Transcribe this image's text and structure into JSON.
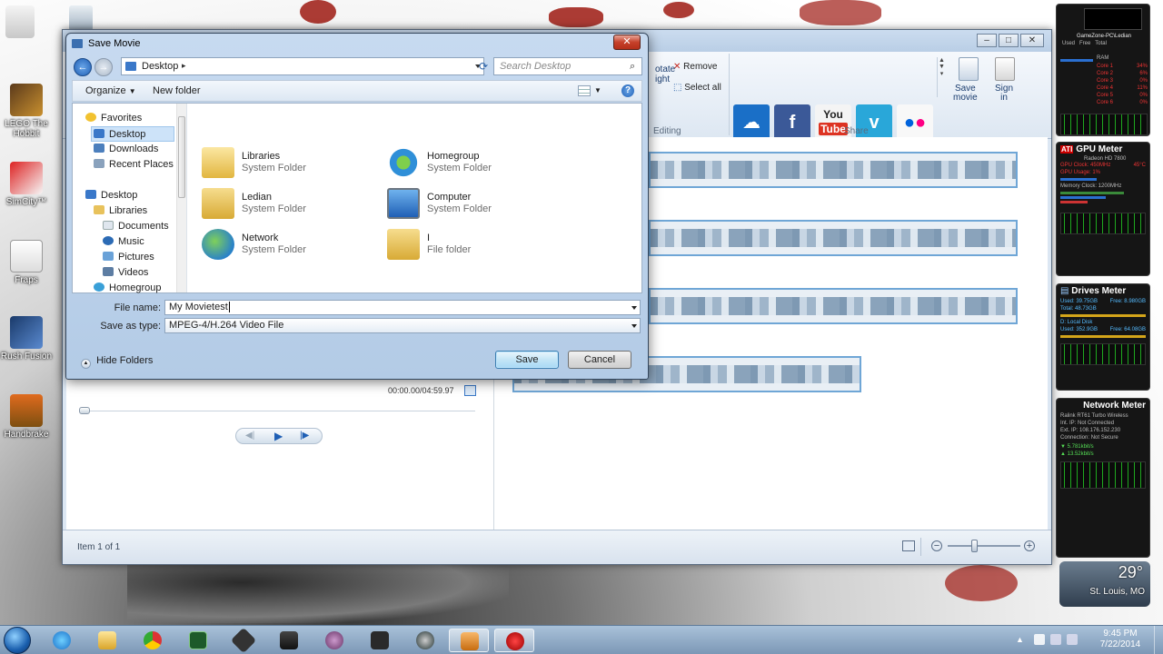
{
  "desktop": {
    "icons": [
      {
        "label": "LEGO The Hobbit"
      },
      {
        "label": "SimCity™"
      },
      {
        "label": "Fraps"
      },
      {
        "label": "Rush Fusion"
      },
      {
        "label": "Handbrake"
      }
    ]
  },
  "moviemaker": {
    "ribbon": {
      "remove": "Remove",
      "select_all": "Select all",
      "rotate_right": "otate\night",
      "editing_group": "Editing",
      "share_group": "Share",
      "save_movie": "Save\nmovie",
      "sign_in": "Sign\nin",
      "share_services": [
        "OneDrive",
        "Facebook",
        "YouTube",
        "Vimeo",
        "Flickr"
      ]
    },
    "preview": {
      "timecode": "00:00.00/04:59.97"
    },
    "status": {
      "item_count": "Item 1 of 1"
    }
  },
  "dialog": {
    "title": "Save Movie",
    "address": "Desktop",
    "search_placeholder": "Search Desktop",
    "toolbar": {
      "organize": "Organize",
      "new_folder": "New folder"
    },
    "nav": {
      "favorites": "Favorites",
      "desktop_fav": "Desktop",
      "downloads": "Downloads",
      "recent_places": "Recent Places",
      "desktop": "Desktop",
      "libraries": "Libraries",
      "documents": "Documents",
      "music": "Music",
      "pictures": "Pictures",
      "videos": "Videos",
      "homegroup": "Homegroup"
    },
    "files": [
      {
        "name": "Libraries",
        "type": "System Folder"
      },
      {
        "name": "Homegroup",
        "type": "System Folder"
      },
      {
        "name": "Ledian",
        "type": "System Folder"
      },
      {
        "name": "Computer",
        "type": "System Folder"
      },
      {
        "name": "Network",
        "type": "System Folder"
      },
      {
        "name": "I",
        "type": "File folder"
      }
    ],
    "file_name_label": "File name:",
    "file_name_value": "My Movietest",
    "save_type_label": "Save as type:",
    "save_type_value": "MPEG-4/H.264 Video File",
    "hide_folders": "Hide Folders",
    "save_button": "Save",
    "cancel_button": "Cancel"
  },
  "gadgets": {
    "cpu": {
      "header": "GameZone-PC\\Ledian",
      "cols": "Used   Free   Total",
      "ram": "RAM",
      "cores": [
        "Core 1",
        "Core 2",
        "Core 3",
        "Core 4",
        "Core 5",
        "Core 6"
      ],
      "percents": [
        "34%",
        "6%",
        "0%",
        "11%",
        "0%",
        "0%"
      ]
    },
    "gpu": {
      "title": "GPU Meter",
      "model": "Radeon HD 7800",
      "clock": "GPU Clock: 450MHz",
      "temp": "45°C",
      "usage": "GPU Usage: 1%",
      "memory": "Memory Clock: 1200MHz"
    },
    "drives": {
      "title": "Drives Meter",
      "c_used": "Used: 39.75GB",
      "c_free": "Free: 8.980GB",
      "c_total": "Total: 48.73GB",
      "d_label": "D: Local Disk",
      "d_used": "Used: 352.9GB",
      "d_free": "Free: 64.08GB"
    },
    "network": {
      "title": "Network Meter",
      "adapter": "Ralink RT61 Turbo Wireless",
      "int_ip": "Int. IP: Not Connected",
      "ext_ip": "Ext. IP: 108.176.152.230",
      "connection": "Connection: Not Secure",
      "down": "5.781kbit/s",
      "up": "13.52kbit/s"
    },
    "weather": {
      "temp": "29°",
      "city": "St. Louis, MO"
    }
  },
  "taskbar": {
    "time": "9:45 PM",
    "date": "7/22/2014"
  }
}
